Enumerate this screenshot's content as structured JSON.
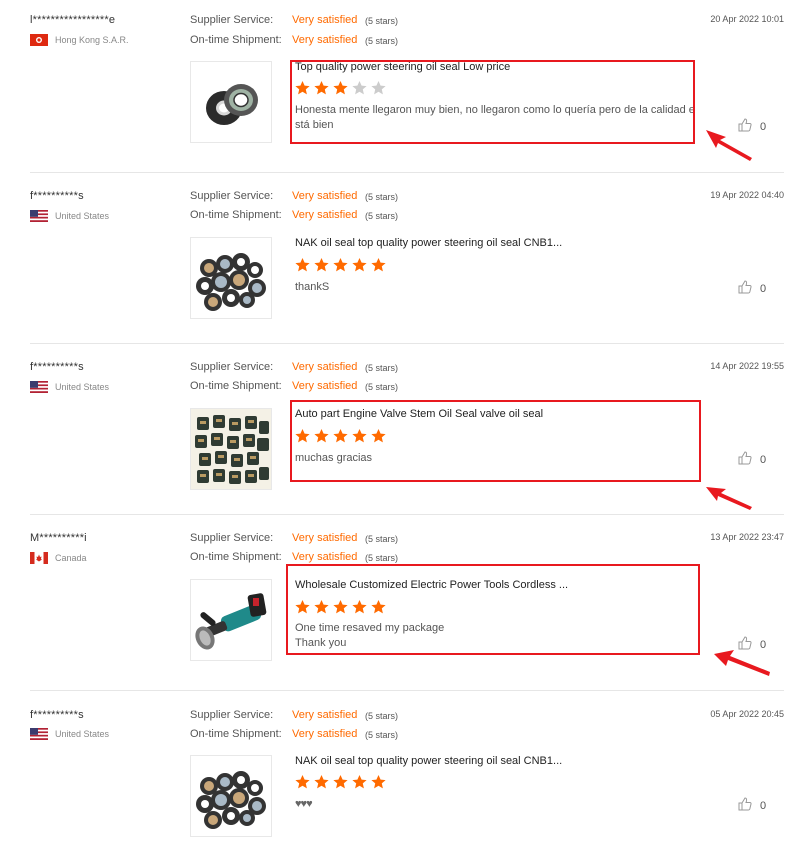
{
  "labels": {
    "supplier_service": "Supplier Service:",
    "ontime_shipment": "On-time Shipment:"
  },
  "colors": {
    "accent": "#ff6a00",
    "highlight": "#e8191f",
    "star_off": "#cccccc"
  },
  "reviews": [
    {
      "user": "l*****************e",
      "country": "Hong Kong S.A.R.",
      "flag": "hk-flag",
      "supplier_service": "Very satisfied",
      "supplier_stars": "(5 stars)",
      "ontime_shipment": "Very satisfied",
      "ontime_stars": "(5 stars)",
      "date": "20 Apr 2022 10:01",
      "product_title": "Top quality power steering oil seal Low price",
      "rating": 3,
      "comment_lines": [
        "Honesta mente llegaron muy bien, no llegaron como lo quería pero de la calidad e",
        "stá bien"
      ],
      "likes": "0"
    },
    {
      "user": "f**********s",
      "country": "United States",
      "flag": "us-flag",
      "supplier_service": "Very satisfied",
      "supplier_stars": "(5 stars)",
      "ontime_shipment": "Very satisfied",
      "ontime_stars": "(5 stars)",
      "date": "19 Apr 2022 04:40",
      "product_title": "NAK oil seal top quality power steering oil seal CNB1...",
      "rating": 5,
      "comment_lines": [
        "thankS"
      ],
      "likes": "0"
    },
    {
      "user": "f**********s",
      "country": "United States",
      "flag": "us-flag",
      "supplier_service": "Very satisfied",
      "supplier_stars": "(5 stars)",
      "ontime_shipment": "Very satisfied",
      "ontime_stars": "(5 stars)",
      "date": "14 Apr 2022 19:55",
      "product_title": "Auto part Engine Valve Stem Oil Seal valve oil seal",
      "rating": 5,
      "comment_lines": [
        "muchas gracias"
      ],
      "likes": "0"
    },
    {
      "user": "M**********i",
      "country": "Canada",
      "flag": "ca-flag",
      "supplier_service": "Very satisfied",
      "supplier_stars": "(5 stars)",
      "ontime_shipment": "Very satisfied",
      "ontime_stars": "(5 stars)",
      "date": "13 Apr 2022 23:47",
      "product_title": "Wholesale Customized Electric Power Tools Cordless ...",
      "rating": 5,
      "comment_lines": [
        "One time resaved my package",
        "Thank you"
      ],
      "likes": "0"
    },
    {
      "user": "f**********s",
      "country": "United States",
      "flag": "us-flag",
      "supplier_service": "Very satisfied",
      "supplier_stars": "(5 stars)",
      "ontime_shipment": "Very satisfied",
      "ontime_stars": "(5 stars)",
      "date": "05 Apr 2022 20:45",
      "product_title": "NAK oil seal top quality power steering oil seal CNB1...",
      "rating": 5,
      "comment_lines": [
        "♥♥♥"
      ],
      "likes": "0"
    }
  ]
}
